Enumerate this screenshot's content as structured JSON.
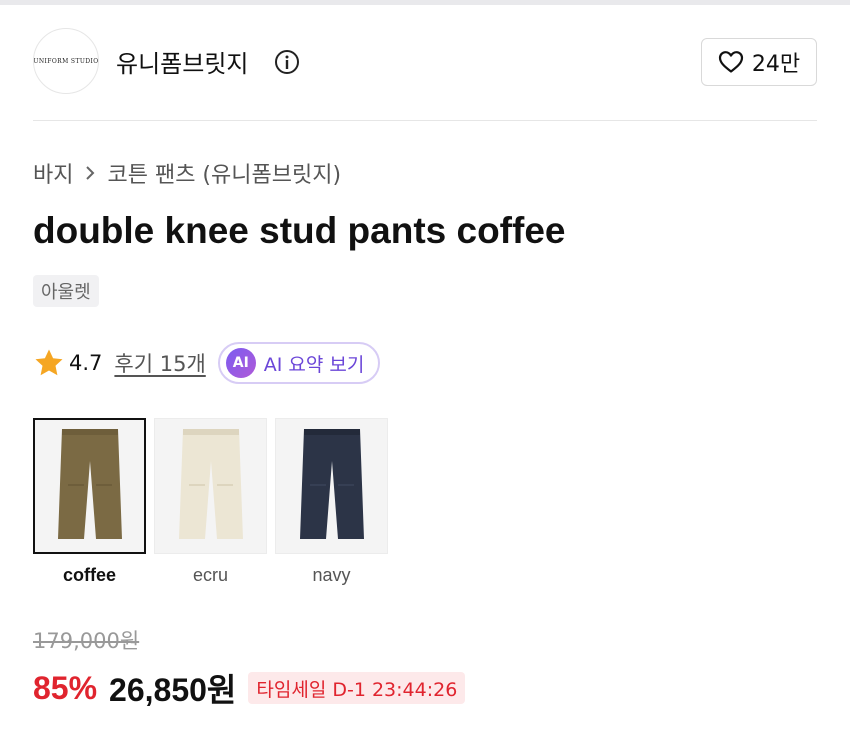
{
  "brand": {
    "logo_text": "UNIFORM STUDIO",
    "name": "유니폼브릿지",
    "like_count": "24만"
  },
  "breadcrumb": {
    "items": [
      "바지",
      "코튼 팬츠 (유니폼브릿지)"
    ]
  },
  "product": {
    "title": "double knee stud pants coffee",
    "badge": "아울렛"
  },
  "rating": {
    "value": "4.7",
    "review_link": "후기 15개",
    "ai_badge": "AI",
    "ai_label": "AI 요약 보기"
  },
  "colors": [
    {
      "label": "coffee",
      "hex": "#7b6a44",
      "selected": true
    },
    {
      "label": "ecru",
      "hex": "#ece6d4",
      "selected": false
    },
    {
      "label": "navy",
      "hex": "#2c3447",
      "selected": false
    }
  ],
  "price": {
    "original": "179,000원",
    "discount": "85%",
    "sale": "26,850원",
    "timesale": "타임세일 D-1 23:44:26"
  },
  "theme": {
    "accent_red": "#e0242e",
    "ai_purple": "#6b46d8",
    "star": "#f5a623"
  }
}
